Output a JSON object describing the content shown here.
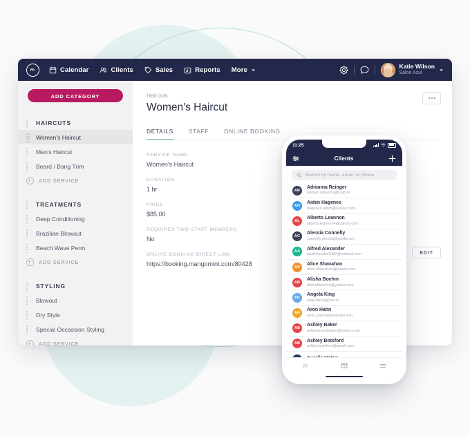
{
  "topnav": {
    "logo": "mangomint-logo",
    "items": [
      {
        "label": "Calendar",
        "icon": "calendar-icon"
      },
      {
        "label": "Clients",
        "icon": "people-icon"
      },
      {
        "label": "Sales",
        "icon": "tag-icon"
      },
      {
        "label": "Reports",
        "icon": "bar-chart-icon"
      },
      {
        "label": "More",
        "icon": "chevron-down-icon"
      }
    ],
    "settings_icon": "gear-icon",
    "messages_icon": "chat-bubble-icon",
    "user": {
      "name": "Katie Wilson",
      "business": "Salon Azul",
      "caret": "chevron-down-icon"
    }
  },
  "sidebar": {
    "add_category_label": "ADD CATEGORY",
    "add_service_label": "ADD SERVICE",
    "groups": [
      {
        "title": "HAIRCUTS",
        "services": [
          {
            "label": "Women's Haircut",
            "active": true
          },
          {
            "label": "Men's Haircut",
            "active": false
          },
          {
            "label": "Beard / Bang Trim",
            "active": false
          }
        ]
      },
      {
        "title": "TREATMENTS",
        "services": [
          {
            "label": "Deep Conditioning",
            "active": false
          },
          {
            "label": "Brazilian Blowout",
            "active": false
          },
          {
            "label": "Beach Wave Perm",
            "active": false
          }
        ]
      },
      {
        "title": "STYLING",
        "services": [
          {
            "label": "Blowout",
            "active": false
          },
          {
            "label": "Dry Style",
            "active": false
          },
          {
            "label": "Special Occassion Styling",
            "active": false
          }
        ]
      }
    ]
  },
  "main": {
    "breadcrumb": "Haircuts",
    "title": "Women's Haircut",
    "kebab_label": "more-options",
    "edit_label": "EDIT",
    "tabs": [
      {
        "label": "DETAILS",
        "active": true
      },
      {
        "label": "STAFF",
        "active": false
      },
      {
        "label": "ONLINE BOOKING",
        "active": false
      }
    ],
    "fields": [
      {
        "label": "SERVICE NAME",
        "value": "Women's Haircut"
      },
      {
        "label": "DURATION",
        "value": "1 hr"
      },
      {
        "label": "PRICE",
        "value": "$85.00"
      },
      {
        "label": "REQUIRES TWO STAFF MEMBERS",
        "value": "No"
      },
      {
        "label": "ONLINE BOOKING DIRECT LINK",
        "value": "https://booking.mangomint.com/80428"
      }
    ]
  },
  "phone": {
    "status": {
      "time": "11:25",
      "signal_icon": "signal-bars-icon",
      "wifi_icon": "wifi-icon",
      "battery_icon": "battery-icon"
    },
    "header": {
      "filter_icon": "filter-sliders-icon",
      "title": "Clients",
      "add_icon": "plus-icon"
    },
    "search": {
      "icon": "search-icon",
      "placeholder": "Search by name, email, or phone"
    },
    "tabbar": [
      {
        "icon": "clients-icon",
        "active": true
      },
      {
        "icon": "calendar-icon",
        "active": false
      },
      {
        "icon": "menu-icon",
        "active": false
      }
    ],
    "clients": [
      {
        "initials": "AR",
        "name": "Adrianna Reinger",
        "email": "reinger.adrianna@calo.tv",
        "color": "#3c4157"
      },
      {
        "initials": "AH",
        "name": "Aiden Hagenes",
        "email": "hagenes.aiden@yahoo.com",
        "color": "#3d9ae8"
      },
      {
        "initials": "AL",
        "name": "Alberto Leannon",
        "email": "alberto.leannon4@yahoo.com",
        "color": "#e8454a"
      },
      {
        "initials": "AC",
        "name": "Alessia Connelly",
        "email": "connelly.alessia@mollie.org",
        "color": "#3c4157"
      },
      {
        "initials": "AA",
        "name": "Alfred Alexander",
        "email": "aaalexander1982@hotmail.com",
        "color": "#17b890"
      },
      {
        "initials": "AS",
        "name": "Alice Shanahan",
        "email": "alice.shanahan@jasper.com",
        "color": "#f0922b"
      },
      {
        "initials": "AB",
        "name": "Alisha Boehm",
        "email": "alishakboehm@yahoo.com",
        "color": "#e8454a"
      },
      {
        "initials": "AK",
        "name": "Angela King",
        "email": "angelaking@me.io",
        "color": "#63a9e8"
      },
      {
        "initials": "AH",
        "name": "Aron Hahn",
        "email": "aron_hahn@bashirian.edu",
        "color": "#efa62b"
      },
      {
        "initials": "AB",
        "name": "Ashley Baker",
        "email": "ashleymariebaker@eeisl.co.uk",
        "color": "#e8454a"
      },
      {
        "initials": "AB",
        "name": "Ashley Botsford",
        "email": "ashley.botsford@gmail.com",
        "color": "#e8454a"
      },
      {
        "initials": "AU",
        "name": "Aurelia Upton",
        "email": "",
        "color": "#2b3a63"
      }
    ]
  },
  "colors": {
    "navy": "#232749",
    "magenta": "#b81a61",
    "teal": "#9ed0ce",
    "page_bg": "#fafafa"
  }
}
